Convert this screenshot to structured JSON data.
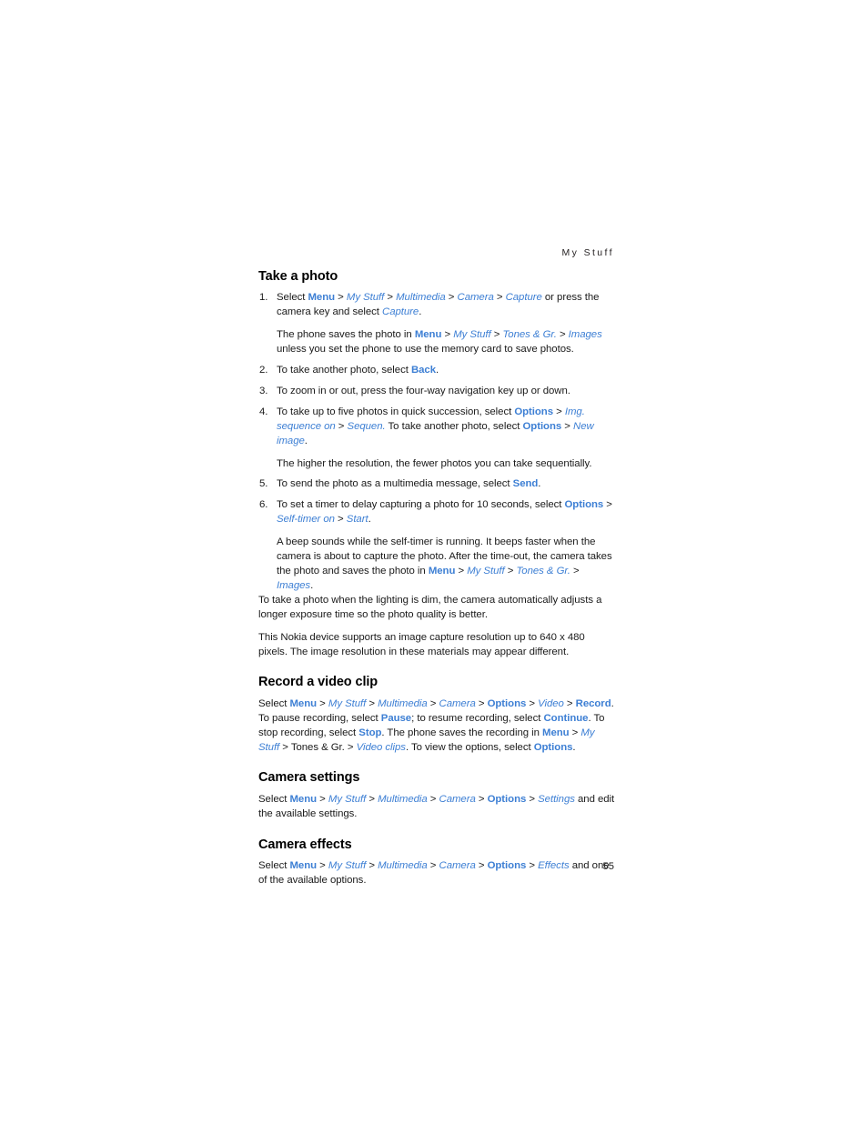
{
  "header": {
    "running_title": "My Stuff"
  },
  "footer": {
    "page_number": "55"
  },
  "sections": {
    "take_a_photo": {
      "title": "Take a photo",
      "steps": {
        "s1": {
          "num": "1.",
          "lead": "Select ",
          "menu": "Menu",
          "my_stuff": "My Stuff",
          "multimedia": "Multimedia",
          "camera": "Camera",
          "capture": "Capture",
          "tail": " or press the camera key and select ",
          "capture2": "Capture",
          "period": ".",
          "note_lead": "The phone saves the photo in ",
          "note_menu": "Menu",
          "note_my_stuff": "My Stuff",
          "note_tones": "Tones & Gr.",
          "note_images": "Images",
          "note_tail": " unless you set the phone to use the memory card to save photos."
        },
        "s2": {
          "num": "2.",
          "lead": "To take another photo, select ",
          "back": "Back",
          "tail": "."
        },
        "s3": {
          "num": "3.",
          "text": "To zoom in or out, press the four-way navigation key up or down."
        },
        "s4": {
          "num": "4.",
          "lead": "To take up to five photos in quick succession, select ",
          "options": "Options",
          "img_sequence_on": "Img. sequence on",
          "sequen": "Sequen.",
          "mid": " To take another photo, select ",
          "options2": "Options",
          "new_image": "New image",
          "tail": ".",
          "note": "The higher the resolution, the fewer photos you can take sequentially."
        },
        "s5": {
          "num": "5.",
          "lead": "To send the photo as a multimedia message, select ",
          "send": "Send",
          "tail": "."
        },
        "s6": {
          "num": "6.",
          "lead": "To set a timer to delay capturing a photo for 10 seconds, select ",
          "options": "Options",
          "self_timer_on": "Self-timer on",
          "start": "Start",
          "tail": ".",
          "note_lead": "A beep sounds while the self-timer is running. It beeps faster when the camera is about to capture the photo. After the time-out, the camera takes the photo and saves the photo in ",
          "note_menu": "Menu",
          "note_my_stuff": "My Stuff",
          "note_tones": "Tones & Gr.",
          "note_images": "Images",
          "note_tail": "."
        }
      },
      "paragraphs": {
        "p1": "To take a photo when the lighting is dim, the camera automatically adjusts a longer exposure time so the photo quality is better.",
        "p2": "This Nokia device supports an image capture resolution up to 640 x 480 pixels. The image resolution in these materials may appear different."
      }
    },
    "record_a_video_clip": {
      "title": "Record a video clip",
      "lead": "Select ",
      "menu": "Menu",
      "my_stuff": "My Stuff",
      "multimedia": "Multimedia",
      "camera": "Camera",
      "options": "Options",
      "video": "Video",
      "record": "Record",
      "t1": ". To pause recording, select ",
      "pause": "Pause",
      "t2": "; to resume recording, select ",
      "continue": "Continue",
      "t3": ". To stop recording, select ",
      "stop": "Stop",
      "t4": ". The phone saves the recording in ",
      "menu2": "Menu",
      "my_stuff2": "My Stuff",
      "tones_plain": "Tones & Gr. ",
      "video_clips": "Video clips",
      "t5": ". To view the options, select ",
      "options2": "Options",
      "t6": "."
    },
    "camera_settings": {
      "title": "Camera settings",
      "lead": "Select ",
      "menu": "Menu",
      "my_stuff": "My Stuff",
      "multimedia": "Multimedia",
      "camera": "Camera",
      "options": "Options",
      "settings": "Settings",
      "tail": " and edit the available settings."
    },
    "camera_effects": {
      "title": "Camera effects",
      "lead": "Select ",
      "menu": "Menu",
      "my_stuff": "My Stuff",
      "multimedia": "Multimedia",
      "camera": "Camera",
      "options": "Options",
      "effects": "Effects",
      "tail": " and one of the available options."
    }
  },
  "symbols": {
    "gt": " > "
  }
}
